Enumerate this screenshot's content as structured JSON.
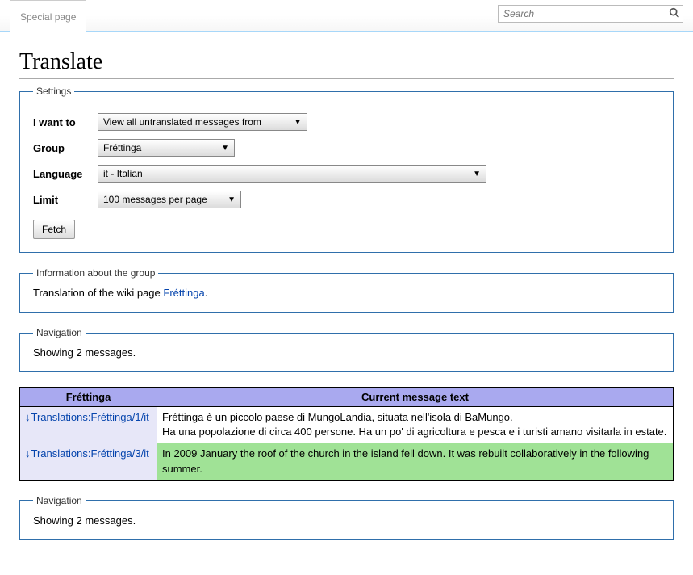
{
  "tab_label": "Special page",
  "search_placeholder": "Search",
  "page_title": "Translate",
  "settings": {
    "legend": "Settings",
    "i_want_to_label": "I want to",
    "i_want_to_value": "View all untranslated messages from",
    "group_label": "Group",
    "group_value": "Fréttinga",
    "language_label": "Language",
    "language_value": "it - Italian",
    "limit_label": "Limit",
    "limit_value": "100 messages per page",
    "fetch_label": "Fetch"
  },
  "info_group": {
    "legend": "Information about the group",
    "text_prefix": "Translation of the wiki page ",
    "link_text": "Fréttinga",
    "text_suffix": "."
  },
  "nav": {
    "legend": "Navigation",
    "text": "Showing 2 messages."
  },
  "table": {
    "header_group": "Fréttinga",
    "header_msg": "Current message text",
    "rows": [
      {
        "name": "Translations:Fréttinga/1/it",
        "text": "Fréttinga è un piccolo paese di MungoLandia, situata nell'isola di BaMungo.\nHa una popolazione di circa 400 persone. Ha un po' di agricoltura e pesca e i turisti amano visitarla in estate.",
        "translated": true
      },
      {
        "name": "Translations:Fréttinga/3/it",
        "text": "In 2009 January the roof of the church in the island fell down. It was rebuilt collaboratively in the following summer.",
        "translated": false
      }
    ]
  }
}
